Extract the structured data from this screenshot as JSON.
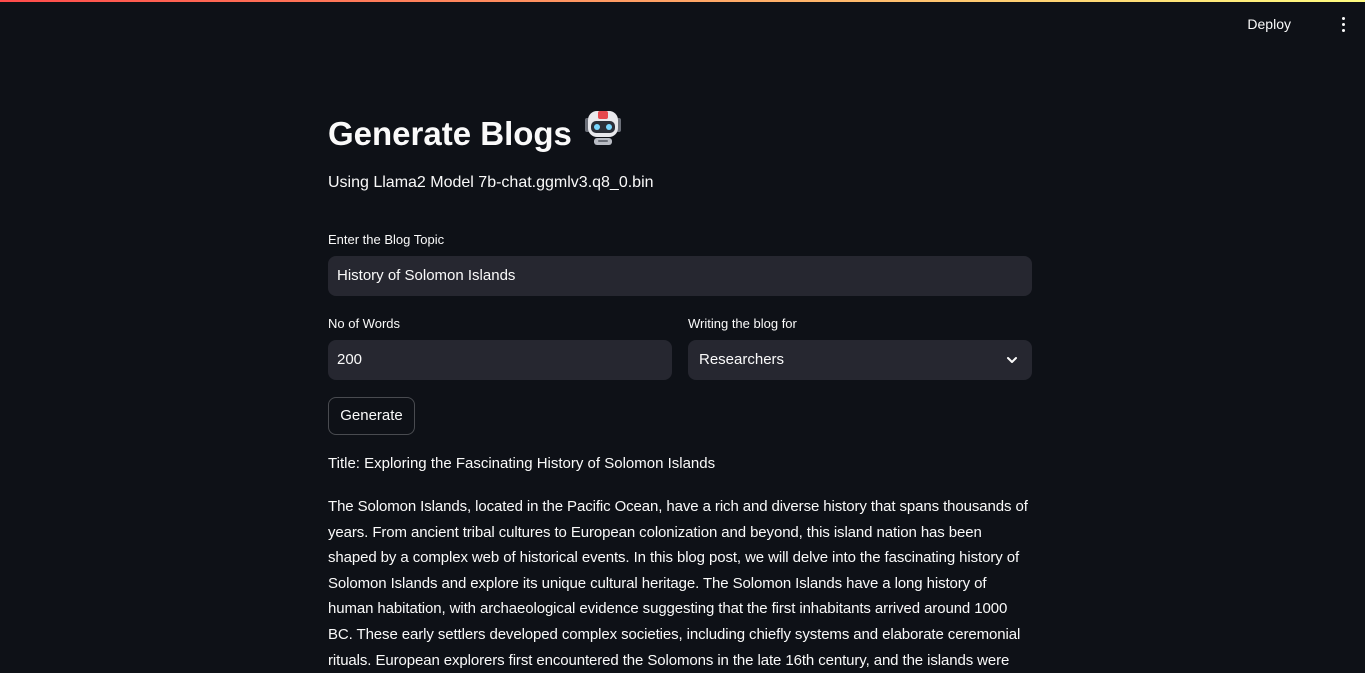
{
  "header": {
    "deploy_label": "Deploy",
    "menu_icon": "kebab-menu-icon"
  },
  "page": {
    "title": "Generate Blogs",
    "title_icon": "robot-icon",
    "subtitle": "Using Llama2 Model 7b-chat.ggmlv3.q8_0.bin"
  },
  "form": {
    "topic_label": "Enter the Blog Topic",
    "topic_value": "History of Solomon Islands",
    "words_label": "No of Words",
    "words_value": "200",
    "audience_label": "Writing the blog for",
    "audience_value": "Researchers",
    "generate_label": "Generate"
  },
  "output": {
    "title": "Title: Exploring the Fascinating History of Solomon Islands",
    "body": "The Solomon Islands, located in the Pacific Ocean, have a rich and diverse history that spans thousands of years. From ancient tribal cultures to European colonization and beyond, this island nation has been shaped by a complex web of historical events. In this blog post, we will delve into the fascinating history of Solomon Islands and explore its unique cultural heritage. The Solomon Islands have a long history of human habitation, with archaeological evidence suggesting that the first inhabitants arrived around 1000 BC. These early settlers developed complex societies, including chiefly systems and elaborate ceremonial rituals. European explorers first encountered the Solomons in the late 16th century, and the islands were"
  },
  "colors": {
    "background": "#0e1117",
    "input_background": "#262730",
    "text": "#fafafa",
    "accent_start": "#ff4b4b",
    "accent_end": "#fffd80"
  }
}
